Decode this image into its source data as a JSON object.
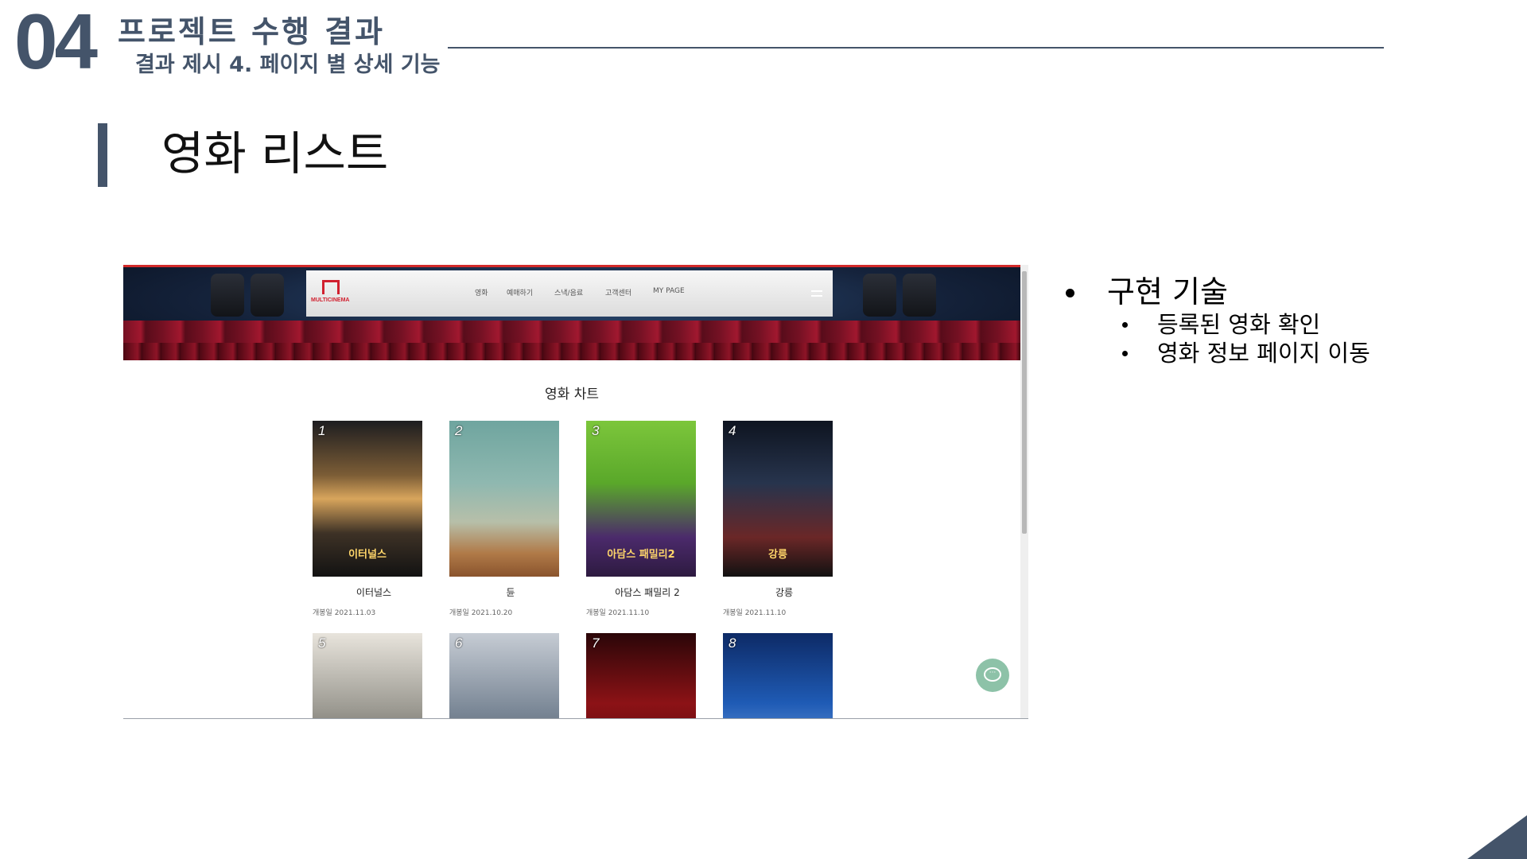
{
  "header": {
    "number": "04",
    "title": "프로젝트 수행 결과",
    "subtitle": "결과 제시 4. 페이지 별 상세 기능"
  },
  "section": {
    "title": "영화 리스트"
  },
  "screenshot": {
    "logo_text": "MULTICINEMA",
    "nav": [
      "영화",
      "예매하기",
      "스낵/음료",
      "고객센터",
      "MY PAGE"
    ],
    "chart_title": "영화 차트",
    "movies": [
      {
        "rank": "1",
        "name": "이터널스",
        "date": "개봉일 2021.11.03",
        "poster_text": "이터널스"
      },
      {
        "rank": "2",
        "name": "듄",
        "date": "개봉일 2021.10.20",
        "poster_text": ""
      },
      {
        "rank": "3",
        "name": "아담스 패밀리 2",
        "date": "개봉일 2021.11.10",
        "poster_text": "아담스 패밀리2"
      },
      {
        "rank": "4",
        "name": "강릉",
        "date": "개봉일 2021.11.10",
        "poster_text": "강릉"
      },
      {
        "rank": "5"
      },
      {
        "rank": "6"
      },
      {
        "rank": "7"
      },
      {
        "rank": "8"
      }
    ]
  },
  "bullets": {
    "main": "구현 기술",
    "items": [
      "등록된 영화 확인",
      "영화 정보 페이지 이동"
    ]
  },
  "colors": {
    "accent": "#44546a",
    "brand_red": "#d1202f",
    "chat": "#8dc2a8"
  }
}
